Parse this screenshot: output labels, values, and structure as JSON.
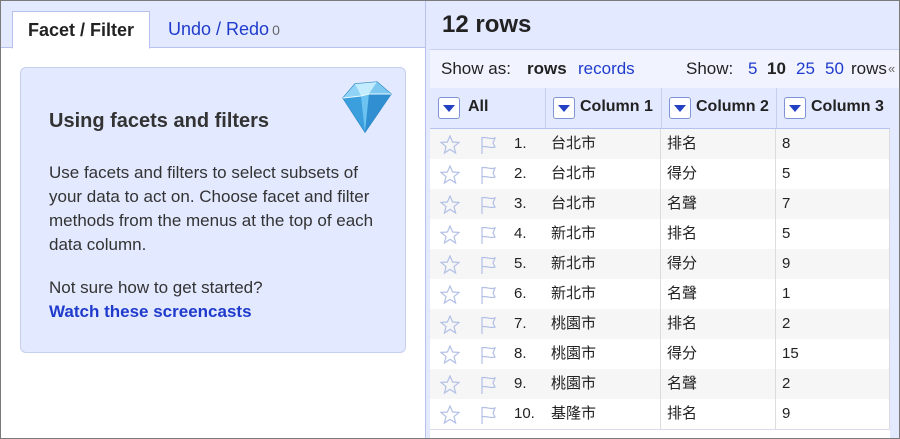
{
  "left_panel": {
    "tabs": [
      {
        "label": "Facet / Filter"
      },
      {
        "label": "Undo / Redo",
        "count": "0"
      }
    ],
    "help": {
      "title": "Using facets and filters",
      "body": "Use facets and filters to select subsets of your data to act on. Choose facet and filter methods from the menus at the top of each data column.",
      "question": "Not sure how to get started?",
      "link": "Watch these screencasts",
      "icon": "diamond-icon"
    }
  },
  "right_panel": {
    "row_count": "12 rows",
    "view": {
      "show_as_label": "Show as:",
      "mode_rows": "rows",
      "mode_records": "records",
      "show_label": "Show:",
      "page_sizes": [
        "5",
        "10",
        "25",
        "50"
      ],
      "selected_page_size": "10",
      "rows_suffix": "rows",
      "pager_arrow": "«"
    },
    "columns": [
      "All",
      "Column 1",
      "Column 2",
      "Column 3"
    ],
    "rows": [
      {
        "index": "1.",
        "c1": "台北市",
        "c2": "排名",
        "c3": "8"
      },
      {
        "index": "2.",
        "c1": "台北市",
        "c2": "得分",
        "c3": "5"
      },
      {
        "index": "3.",
        "c1": "台北市",
        "c2": "名聲",
        "c3": "7"
      },
      {
        "index": "4.",
        "c1": "新北市",
        "c2": "排名",
        "c3": "5"
      },
      {
        "index": "5.",
        "c1": "新北市",
        "c2": "得分",
        "c3": "9"
      },
      {
        "index": "6.",
        "c1": "新北市",
        "c2": "名聲",
        "c3": "1"
      },
      {
        "index": "7.",
        "c1": "桃園市",
        "c2": "排名",
        "c3": "2"
      },
      {
        "index": "8.",
        "c1": "桃園市",
        "c2": "得分",
        "c3": "15"
      },
      {
        "index": "9.",
        "c1": "桃園市",
        "c2": "名聲",
        "c3": "2"
      },
      {
        "index": "10.",
        "c1": "基隆市",
        "c2": "排名",
        "c3": "9"
      }
    ]
  },
  "colors": {
    "accent_blue": "#1f3bcc",
    "panel_bg": "#e3e9ff",
    "row_alt": "#f6f6f6"
  }
}
